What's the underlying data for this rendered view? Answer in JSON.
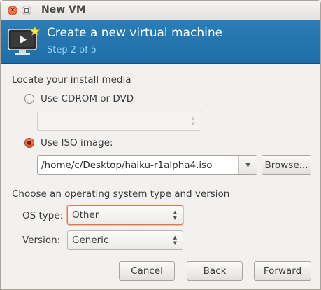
{
  "window": {
    "title": "New VM"
  },
  "banner": {
    "title": "Create a new virtual machine",
    "step": "Step 2 of 5"
  },
  "install_media": {
    "section_label": "Locate your install media",
    "cdrom_label": "Use CDROM or DVD",
    "cdrom_selected": false,
    "cdrom_value": "",
    "iso_label": "Use ISO image:",
    "iso_selected": true,
    "iso_path": "/home/c/Desktop/haiku-r1alpha4.iso",
    "browse_label": "Browse..."
  },
  "os": {
    "section_label": "Choose an operating system type and version",
    "type_label": "OS type:",
    "type_value": "Other",
    "version_label": "Version:",
    "version_value": "Generic"
  },
  "buttons": {
    "cancel": "Cancel",
    "back": "Back",
    "forward": "Forward"
  },
  "colors": {
    "banner": "#2a7db7",
    "step_text": "#8ed3f7",
    "radio_selected": "#de5529"
  },
  "icons": {
    "banner": "virtual-machine-monitor-icon",
    "close": "close-icon",
    "maximize": "maximize-icon",
    "spin": "up-down-arrows-icon",
    "dropdown": "chevron-down-icon"
  }
}
